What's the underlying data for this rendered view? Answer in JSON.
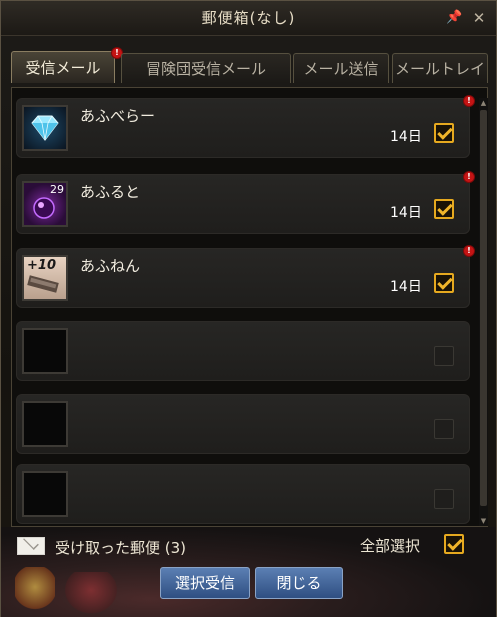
{
  "window": {
    "title": "郵便箱(なし)"
  },
  "tabs": [
    {
      "label": "受信メール",
      "active": true,
      "new": "!"
    },
    {
      "label": "冒険団受信メール",
      "active": false
    },
    {
      "label": "メール送信",
      "active": false
    },
    {
      "label": "メールトレイ",
      "active": false
    }
  ],
  "mails": [
    {
      "sender": "あふべらー",
      "days": "14日",
      "checked": true,
      "new": "!",
      "icon": "diamond-item-icon"
    },
    {
      "sender": "あふると",
      "days": "14日",
      "checked": true,
      "new": "!",
      "icon": "purple-orb-item-icon",
      "count": "29"
    },
    {
      "sender": "あふねん",
      "days": "14日",
      "checked": true,
      "new": "!",
      "icon": "plus10-upgrade-item-icon",
      "tag": "+10"
    }
  ],
  "empty_slots": 3,
  "footer": {
    "received_label": "受け取った郵便 (3)",
    "select_all_label": "全部選択",
    "select_all_checked": true,
    "receive_selected": "選択受信",
    "close": "閉じる"
  },
  "colors": {
    "accent": "#e6a91f",
    "button": "#3d5f95",
    "badge": "#c41414"
  }
}
